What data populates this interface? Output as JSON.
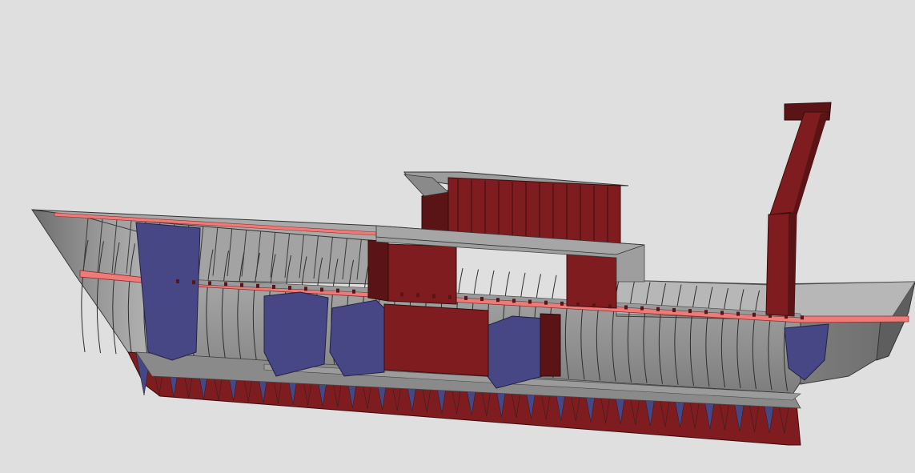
{
  "scene": {
    "subject": "ship-hull-3d-structural-model",
    "palette": {
      "background": "#dfdfdf",
      "shell": "#8c8c8c",
      "shell_dark": "#6a6a6a",
      "frame_line": "#2e2e2e",
      "bulkhead_red": "#7e1c1f",
      "bulkhead_red_dark": "#5a1416",
      "transverse_blue": "#474785",
      "transverse_blue_dark": "#303063",
      "deck_edge_pink": "#f07a78",
      "deck_grey": "#9a9a9a"
    }
  }
}
